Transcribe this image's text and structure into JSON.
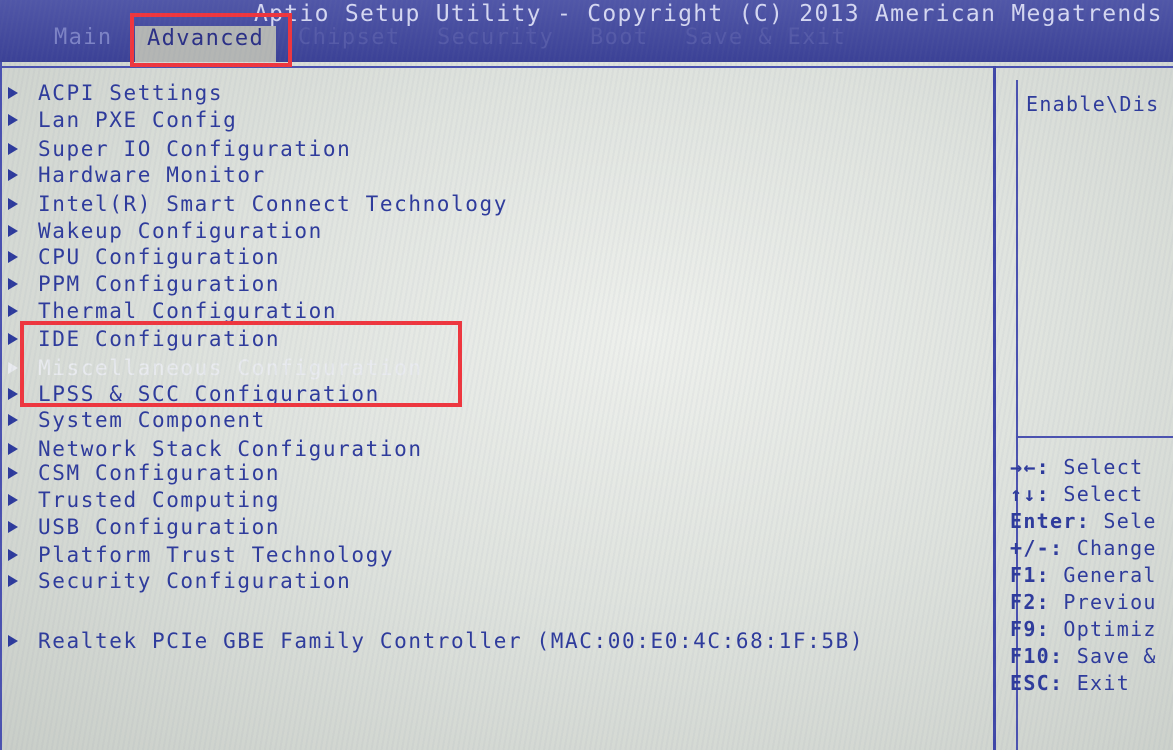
{
  "header": {
    "title": "Aptio Setup Utility - Copyright (C) 2013 American Megatrends",
    "tabs": [
      {
        "label": "Main"
      },
      {
        "label": "Advanced"
      },
      {
        "label": "Chipset"
      },
      {
        "label": "Security"
      },
      {
        "label": "Boot"
      },
      {
        "label": "Save & Exit"
      }
    ],
    "active_tab": "Advanced"
  },
  "menu": {
    "items": [
      {
        "label": "ACPI Settings"
      },
      {
        "label": "Lan PXE Config"
      },
      {
        "label": "Super IO Configuration"
      },
      {
        "label": "Hardware Monitor"
      },
      {
        "label": "Intel(R) Smart Connect Technology"
      },
      {
        "label": "Wakeup Configuration"
      },
      {
        "label": "CPU Configuration"
      },
      {
        "label": "PPM Configuration"
      },
      {
        "label": "Thermal Configuration"
      },
      {
        "label": "IDE Configuration"
      },
      {
        "label": "Miscellaneous Configuration"
      },
      {
        "label": "LPSS & SCC Configuration"
      },
      {
        "label": "System Component"
      },
      {
        "label": "Network Stack Configuration"
      },
      {
        "label": "CSM Configuration"
      },
      {
        "label": "Trusted Computing"
      },
      {
        "label": "USB Configuration"
      },
      {
        "label": "Platform Trust Technology"
      },
      {
        "label": "Security Configuration"
      }
    ],
    "extra_item": {
      "label": "Realtek PCIe GBE Family Controller (MAC:00:E0:4C:68:1F:5B)"
    }
  },
  "help": {
    "description": "Enable\\Dis",
    "keys": [
      {
        "key": "→←:",
        "action": "Select"
      },
      {
        "key": "↑↓:",
        "action": "Select"
      },
      {
        "key": "Enter:",
        "action": "Sele"
      },
      {
        "key": "+/-:",
        "action": "Change"
      },
      {
        "key": "F1:",
        "action": "General"
      },
      {
        "key": "F2:",
        "action": "Previou"
      },
      {
        "key": "F9:",
        "action": "Optimiz"
      },
      {
        "key": "F10:",
        "action": "Save &"
      },
      {
        "key": "ESC:",
        "action": "Exit"
      }
    ]
  },
  "colors": {
    "header_bg": "#3b4196",
    "menu_text": "#2d3a9c",
    "inactive_text": "#e9ebef",
    "highlight_box": "#f0353d"
  }
}
